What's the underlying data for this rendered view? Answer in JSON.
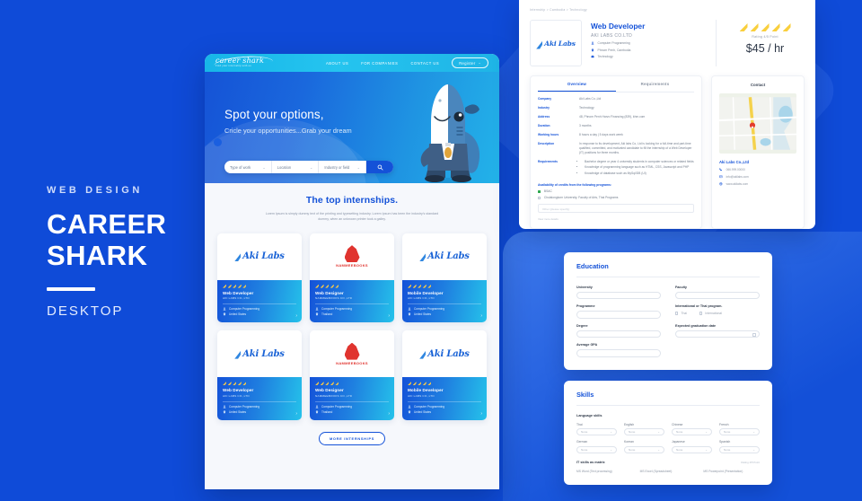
{
  "caption": {
    "eyebrow": "WEB DESIGN",
    "title_line1": "CAREER",
    "title_line2": "SHARK",
    "subtitle": "DESKTOP"
  },
  "site": {
    "logo_text": "career shark",
    "logo_sub": "Find your internship with us",
    "nav": [
      {
        "label": "ABOUT US"
      },
      {
        "label": "FOR COMPANIES"
      },
      {
        "label": "CONTACT US"
      }
    ],
    "register_label": "Register",
    "register_caret": "⌄"
  },
  "hero": {
    "title": "Spot your options,",
    "subtitle": "Cricle your opportunities...Grab your dream",
    "search": {
      "fields": [
        {
          "placeholder": "Type of work"
        },
        {
          "placeholder": "Location"
        },
        {
          "placeholder": "Industry or field"
        }
      ],
      "caret": "⌄",
      "button_icon": "search-icon"
    }
  },
  "internships": {
    "title": "The top internships.",
    "description": "Lorem Ipsum is simply dummy text of the printing and typesetting industry. Lorem Ipsum has been the industry's standard dummy, when an unknown printer took a galley.",
    "more_label": "MORE INTERNSHIPS",
    "cards": [
      {
        "logo": "aki-labs",
        "logo_text": "Aki Labs",
        "role": "Web Developer",
        "company": "AKI LABS CO.,LTD",
        "field": "Computer Programming",
        "location": "United States",
        "rating": 5
      },
      {
        "logo": "nammeebooks",
        "logo_text": "NAMMEEBOOKS",
        "role": "Web Designer",
        "company": "NAMMEEBOOKS CO.,LTD",
        "field": "Computer Programming",
        "location": "Thailand",
        "rating": 5
      },
      {
        "logo": "aki-labs",
        "logo_text": "Aki Labs",
        "role": "Mobile Developer",
        "company": "AKI LABS CO.,LTD",
        "field": "Computer Programming",
        "location": "United States",
        "rating": 5
      },
      {
        "logo": "aki-labs",
        "logo_text": "Aki Labs",
        "role": "Web Developer",
        "company": "AKI LABS CO.,LTD",
        "field": "Computer Programming",
        "location": "United States",
        "rating": 5
      },
      {
        "logo": "nammeebooks",
        "logo_text": "NAMMEEBOOKS",
        "role": "Web Designer",
        "company": "NAMMEEBOOKS CO.,LTD",
        "field": "Computer Programming",
        "location": "Thailand",
        "rating": 5
      },
      {
        "logo": "aki-labs",
        "logo_text": "Aki Labs",
        "role": "Mobile Developer",
        "company": "AKI LABS CO.,LTD",
        "field": "Computer Programming",
        "location": "United States",
        "rating": 5
      }
    ]
  },
  "detail": {
    "breadcrumb": "Internship  >  Cambodia  >  Technology",
    "logo_text": "Aki Labs",
    "role": "Web Developer",
    "company": "AKI LABS CO.LTD",
    "meta": [
      {
        "icon": "person-icon",
        "label": "Computer Programming"
      },
      {
        "icon": "pin-icon",
        "label": "Phnom Penh, Cambodia"
      },
      {
        "icon": "briefcase-icon",
        "label": "Technology"
      }
    ],
    "rating_count": 5,
    "rating_label": "Rating 4/5 Point",
    "price": "$45 / hr",
    "tabs": [
      {
        "label": "Overview",
        "active": true
      },
      {
        "label": "Requirements",
        "active": false
      }
    ],
    "rows": [
      {
        "key": "Company",
        "value": "Aki Labs Co.,Ltd"
      },
      {
        "key": "Industry",
        "value": "Technology"
      },
      {
        "key": "Address",
        "value": "48, Phnom Penh Harvo Financing (839), khm.com"
      },
      {
        "key": "Duration",
        "value": "3 months"
      },
      {
        "key": "Working hours",
        "value": "8 hours a day | 5 days work week"
      },
      {
        "key": "Description",
        "value": "In response to its development, Aki labs Co, Ltd is looking for a full-time and part-time qualified, committed, and motivated candidate to fill the internship of a Web Developer (IT) positions for three months."
      }
    ],
    "requirements_key": "Requirements",
    "requirements": [
      "Bachelor degree or year 4 university students in computer sciences or related fields",
      "Knowledge of programming language such as HTML, CSS, Javascript and PHP",
      "Knowledge of database such as MySql/DB (UI)"
    ],
    "availability_title": "Availability of credits from the following programs:",
    "availability": [
      {
        "label": "BSAC",
        "checked": true
      },
      {
        "label": "Chulalongkorn University, Faculty of Arts, Thai Programs",
        "checked": false
      }
    ],
    "other_placeholder": "Other (please specify)",
    "view_all": "View more details",
    "contact": {
      "title": "Contact",
      "name": "Aki Labs Co.,Ltd",
      "rows": [
        {
          "icon": "phone-icon",
          "label": "066.999.00000"
        },
        {
          "icon": "mail-icon",
          "label": "info@akilabs.com"
        },
        {
          "icon": "globe-icon",
          "label": "www.akilabs.com"
        }
      ]
    }
  },
  "education": {
    "title": "Education",
    "fields": [
      {
        "label": "University",
        "value": ""
      },
      {
        "label": "Faculty",
        "value": ""
      },
      {
        "label": "Programme",
        "value": ""
      }
    ],
    "program_label": "International or Thai program.",
    "program_options": [
      {
        "label": "Thai"
      },
      {
        "label": "International"
      }
    ],
    "degree_label": "Degree",
    "grad_label": "Expected graduation date",
    "gpa_label": "Average GPA"
  },
  "skills": {
    "title": "Skills",
    "language_label": "Language skills",
    "languages": [
      {
        "name": "Thai",
        "value": "None"
      },
      {
        "name": "English",
        "value": "None"
      },
      {
        "name": "Chinese",
        "value": "None"
      },
      {
        "name": "French",
        "value": "None"
      },
      {
        "name": "German",
        "value": "None"
      },
      {
        "name": "Korean",
        "value": "None"
      },
      {
        "name": "Japanese",
        "value": "None"
      },
      {
        "name": "Spanish",
        "value": "None"
      }
    ],
    "select_caret": "⌄",
    "it_title": "IT skills as matrix",
    "it_rating": "Rating 4/5 Point",
    "it_columns": [
      {
        "label": "MS Word (Text processing)"
      },
      {
        "label": "MS Excel (Spreadsheet)"
      },
      {
        "label": "MS Powerpoint (Presentation)"
      }
    ]
  },
  "colors": {
    "brand_blue": "#1452d8",
    "page_blue": "#0f4bd8",
    "cyan": "#25c4ef",
    "accent_yellow": "#f9cf3d",
    "red_logo": "#e0342f"
  }
}
